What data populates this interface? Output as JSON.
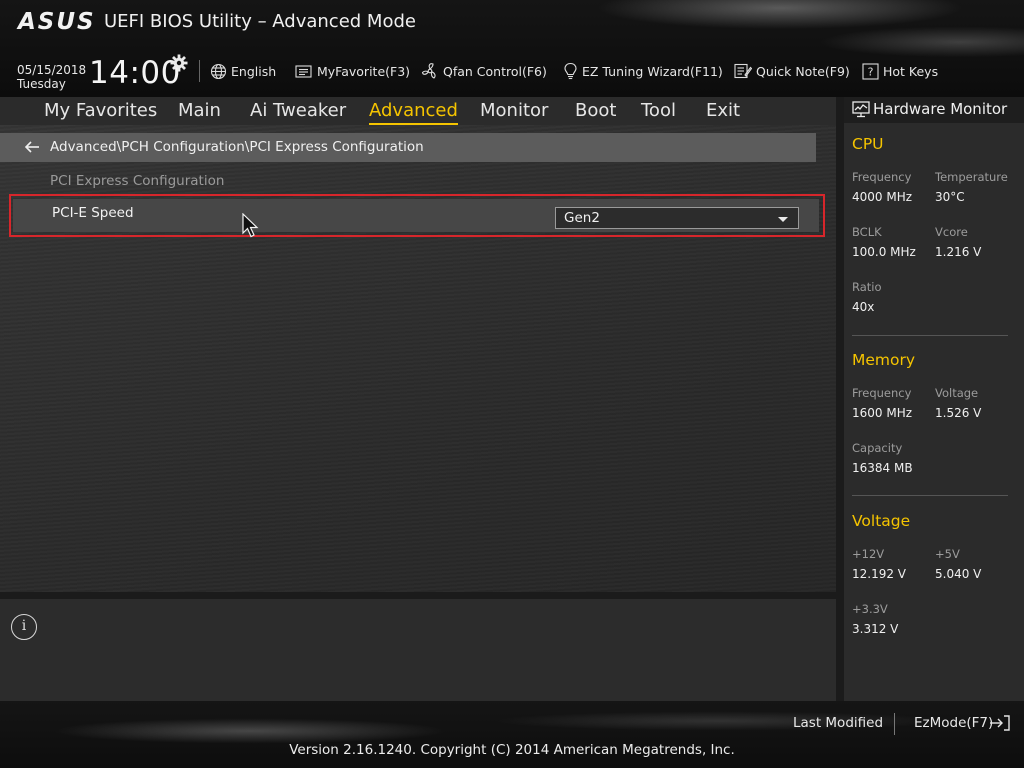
{
  "header": {
    "logo": "ASUS",
    "title": "UEFI BIOS Utility – Advanced Mode",
    "date": "05/15/2018",
    "day": "Tuesday",
    "time": "14:00",
    "tools": {
      "language": "English",
      "myfavorite": "MyFavorite(F3)",
      "qfan": "Qfan Control(F6)",
      "ez_tuning": "EZ Tuning Wizard(F11)",
      "quick_note": "Quick Note(F9)",
      "hot_keys": "Hot Keys"
    }
  },
  "nav": {
    "tabs": [
      {
        "label": "My Favorites"
      },
      {
        "label": "Main"
      },
      {
        "label": "Ai Tweaker"
      },
      {
        "label": "Advanced"
      },
      {
        "label": "Monitor"
      },
      {
        "label": "Boot"
      },
      {
        "label": "Tool"
      },
      {
        "label": "Exit"
      }
    ],
    "active_tab": "Advanced"
  },
  "main": {
    "breadcrumb": "Advanced\\PCH Configuration\\PCI Express Configuration",
    "section_title": "PCI Express Configuration",
    "settings": [
      {
        "label": "PCI-E Speed",
        "value": "Gen2"
      }
    ]
  },
  "hardware_monitor": {
    "title": "Hardware Monitor",
    "cpu": {
      "heading": "CPU",
      "frequency_label": "Frequency",
      "frequency": "4000 MHz",
      "temperature_label": "Temperature",
      "temperature": "30°C",
      "bclk_label": "BCLK",
      "bclk": "100.0 MHz",
      "vcore_label": "Vcore",
      "vcore": "1.216 V",
      "ratio_label": "Ratio",
      "ratio": "40x"
    },
    "memory": {
      "heading": "Memory",
      "frequency_label": "Frequency",
      "frequency": "1600 MHz",
      "voltage_label": "Voltage",
      "voltage": "1.526 V",
      "capacity_label": "Capacity",
      "capacity": "16384 MB"
    },
    "voltage": {
      "heading": "Voltage",
      "v12_label": "+12V",
      "v12": "12.192 V",
      "v5_label": "+5V",
      "v5": "5.040 V",
      "v33_label": "+3.3V",
      "v33": "3.312 V"
    }
  },
  "footer": {
    "last_modified": "Last Modified",
    "ezmode": "EzMode(F7)",
    "copyright": "Version 2.16.1240. Copyright (C) 2014 American Megatrends, Inc."
  },
  "colors": {
    "accent": "#f5c400",
    "highlight_border": "#d7262b"
  }
}
